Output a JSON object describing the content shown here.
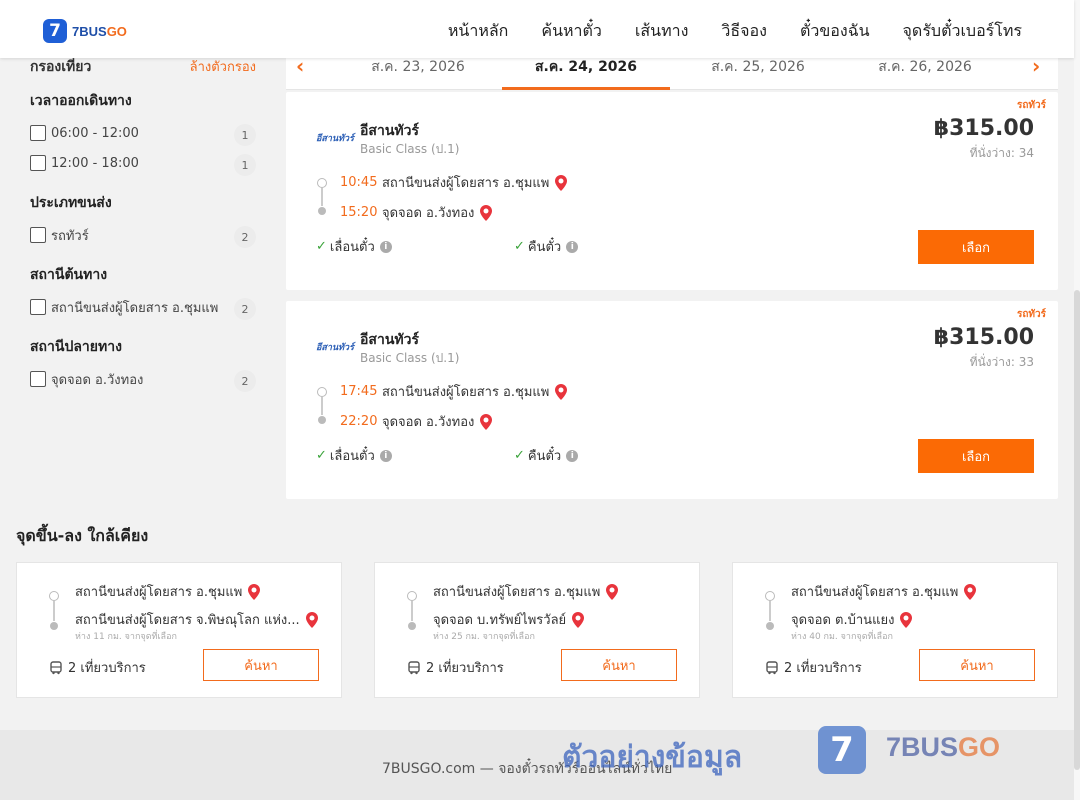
{
  "header": {
    "logo_badge": "7",
    "logo_text_a": "7BUS",
    "logo_text_b": "GO",
    "nav": [
      "หน้าหลัก",
      "ค้นหาตั๋ว",
      "เส้นทาง",
      "วิธีจอง",
      "ตั๋วของฉัน",
      "จุดรับตั๋วเบอร์โทร"
    ]
  },
  "sidebar": {
    "filter_title": "กรองเที่ยว",
    "clear_filter": "ล้างตัวกรอง",
    "groups": [
      {
        "title": "เวลาออกเดินทาง",
        "options": [
          {
            "label": "06:00 - 12:00",
            "count": "1"
          },
          {
            "label": "12:00 - 18:00",
            "count": "1"
          }
        ]
      },
      {
        "title": "ประเภทขนส่ง",
        "options": [
          {
            "label": "รถทัวร์",
            "count": "2"
          }
        ]
      },
      {
        "title": "สถานีต้นทาง",
        "options": [
          {
            "label": "สถานีขนส่งผู้โดยสาร อ.ชุมแพ",
            "count": "2"
          }
        ]
      },
      {
        "title": "สถานีปลายทาง",
        "options": [
          {
            "label": "จุดจอด อ.วังทอง",
            "count": "2"
          }
        ]
      }
    ]
  },
  "dates": {
    "prev_icon": "chevron-left-icon",
    "next_icon": "chevron-right-icon",
    "tabs": [
      "ส.ค. 23, 2026",
      "ส.ค. 24, 2026",
      "ส.ค. 25, 2026",
      "ส.ค. 26, 2026"
    ],
    "active_index": 1
  },
  "trips": [
    {
      "tag": "รถทัวร์",
      "logo_text": "อีสานทัวร์",
      "operator": "อีสานทัวร์",
      "class": "Basic Class (ป.1)",
      "price": "฿315.00",
      "seats": "ที่นั่งว่าง: 34",
      "depart_time": "10:45",
      "depart_station": "สถานีขนส่งผู้โดยสาร อ.ชุมแพ",
      "arrive_time": "15:20",
      "arrive_station": "จุดจอด อ.วังทอง",
      "feature_1": "เลื่อนตั๋ว",
      "feature_2": "คืนตั๋ว",
      "select_label": "เลือก"
    },
    {
      "tag": "รถทัวร์",
      "logo_text": "อีสานทัวร์",
      "operator": "อีสานทัวร์",
      "class": "Basic Class (ป.1)",
      "price": "฿315.00",
      "seats": "ที่นั่งว่าง: 33",
      "depart_time": "17:45",
      "depart_station": "สถานีขนส่งผู้โดยสาร อ.ชุมแพ",
      "arrive_time": "22:20",
      "arrive_station": "จุดจอด อ.วังทอง",
      "feature_1": "เลื่อนตั๋ว",
      "feature_2": "คืนตั๋ว",
      "select_label": "เลือก"
    }
  ],
  "nearby": {
    "title": "จุดขึ้น-ลง ใกล้เคียง",
    "cards": [
      {
        "from": "สถานีขนส่งผู้โดยสาร อ.ชุมแพ",
        "to": "สถานีขนส่งผู้โดยสาร จ.พิษณุโลก แห่ง...",
        "distance": "ห่าง 11 กม. จากจุดที่เลือก",
        "trips": "2 เที่ยวบริการ",
        "button": "ค้นหา"
      },
      {
        "from": "สถานีขนส่งผู้โดยสาร อ.ชุมแพ",
        "to": "จุดจอด บ.ทรัพย์ไพรวัลย์",
        "distance": "ห่าง 25 กม. จากจุดที่เลือก",
        "trips": "2 เที่ยวบริการ",
        "button": "ค้นหา"
      },
      {
        "from": "สถานีขนส่งผู้โดยสาร อ.ชุมแพ",
        "to": "จุดจอด ต.บ้านแยง",
        "distance": "ห่าง 40 กม. จากจุดที่เลือก",
        "trips": "2 เที่ยวบริการ",
        "button": "ค้นหา"
      }
    ]
  },
  "footer": {
    "text": "7BUSGO.com — จองตั๋วรถทัวร์ออนไลน์ทั่วไทย",
    "watermark_text": "ตัวอย่างข้อมูล",
    "watermark_badge": "7",
    "watermark_name_a": "7BUS",
    "watermark_name_b": "GO"
  },
  "colors": {
    "accent": "#fb6a05",
    "brand_blue": "#1f5fd6",
    "check": "#3aa33a"
  }
}
